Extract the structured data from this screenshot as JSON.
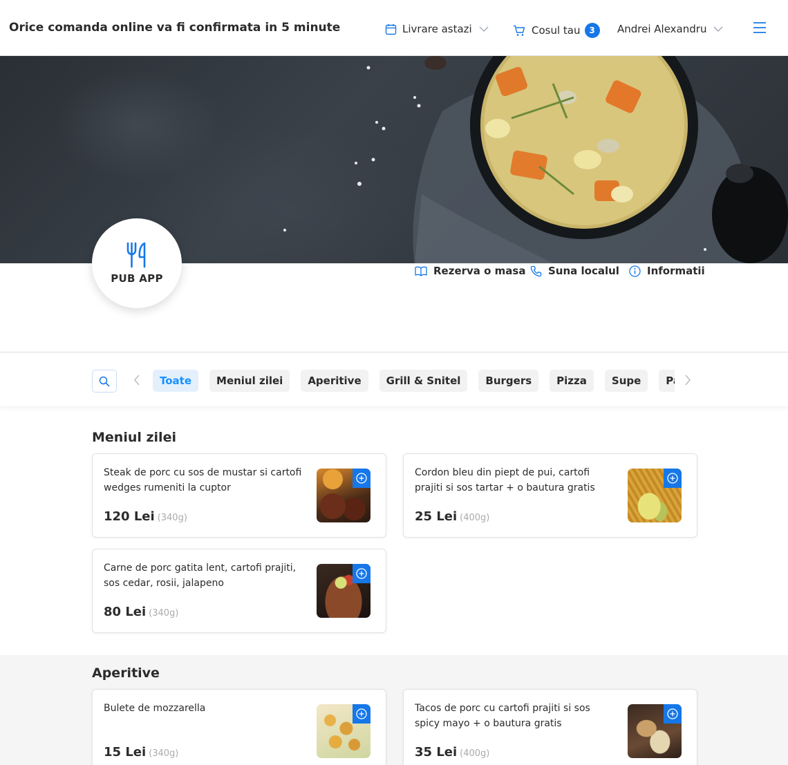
{
  "header": {
    "title": "Orice comanda online va fi confirmata in 5 minute",
    "delivery_label": "Livrare astazi",
    "cart_label": "Cosul tau",
    "cart_count": "3",
    "user_name": "Andrei Alexandru",
    "icons": [
      "calendar-icon",
      "cart-icon",
      "chevron-down-icon",
      "hamburger-menu-icon"
    ]
  },
  "restaurant": {
    "logo_text": "PUB APP",
    "actions": [
      {
        "label": "Rezerva o masa",
        "icon": "book-icon"
      },
      {
        "label": "Suna localul",
        "icon": "phone-icon"
      },
      {
        "label": "Informatii",
        "icon": "info-icon"
      }
    ]
  },
  "categories": {
    "items": [
      "Toate",
      "Meniul zilei",
      "Aperitive",
      "Grill & Snitel",
      "Burgers",
      "Pizza",
      "Supe",
      "Paste"
    ],
    "active": "Toate"
  },
  "sections": [
    {
      "title": "Meniul zilei",
      "products": [
        {
          "name": "Steak de porc cu sos de mustar si cartofi wedges rumeniti la cuptor",
          "price": "120 Lei",
          "weight": "(340g)"
        },
        {
          "name": "Cordon bleu din piept de pui, cartofi prajiti si sos tartar + o bautura gratis",
          "price": "25 Lei",
          "weight": "(400g)"
        },
        {
          "name": "Carne de porc gatita lent, cartofi prajiti, sos cedar, rosii, jalapeno",
          "price": "80 Lei",
          "weight": "(340g)"
        }
      ]
    },
    {
      "title": "Aperitive",
      "products": [
        {
          "name": "Bulete de mozzarella",
          "price": "15 Lei",
          "weight": "(340g)"
        },
        {
          "name": "Tacos de porc cu cartofi prajiti si sos spicy mayo + o bautura gratis",
          "price": "35 Lei",
          "weight": "(400g)"
        }
      ]
    }
  ],
  "colors": {
    "accent": "#1677e8",
    "chip_active_bg": "#e3f0fc",
    "chip_bg": "#f2f2f2",
    "text": "#2b2b2b"
  }
}
